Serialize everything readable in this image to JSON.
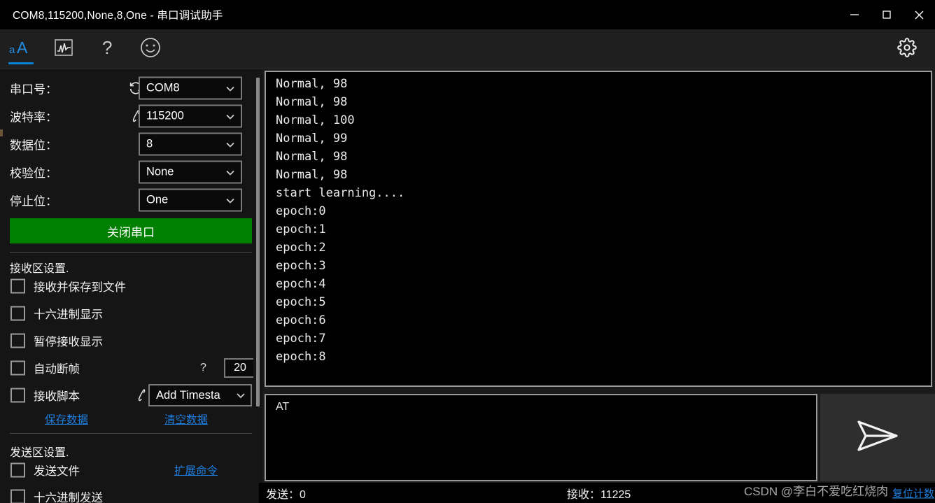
{
  "window": {
    "title": "COM8,115200,None,8,One - 串口调试助手",
    "minimize_label": "minimize",
    "maximize_label": "maximize",
    "close_label": "close"
  },
  "toolbar": {
    "items": [
      {
        "name": "font-size-icon",
        "label": "aA",
        "active": true
      },
      {
        "name": "waveform-plot-icon",
        "label": "waveform",
        "active": false
      },
      {
        "name": "help-question-icon",
        "label": "?",
        "active": false
      },
      {
        "name": "smiley-face-icon",
        "label": "smiley",
        "active": false
      }
    ],
    "settings_label": "gear-icon"
  },
  "sidebar": {
    "port_settings": [
      {
        "label": "串口号：",
        "value": "COM8",
        "icon": "refresh-icon"
      },
      {
        "label": "波特率：",
        "value": "115200",
        "icon": "script-pen-icon"
      },
      {
        "label": "数据位：",
        "value": "8",
        "icon": ""
      },
      {
        "label": "校验位：",
        "value": "None",
        "icon": ""
      },
      {
        "label": "停止位：",
        "value": "One",
        "icon": ""
      }
    ],
    "open_close_button": "关闭串口",
    "receive_section_title": "接收区设置.",
    "receive_checkboxes": [
      {
        "label": "接收并保存到文件",
        "checked": false
      },
      {
        "label": "十六进制显示",
        "checked": false
      },
      {
        "label": "暂停接收显示",
        "checked": false
      },
      {
        "label": "自动断帧",
        "checked": false
      },
      {
        "label": "接收脚本",
        "checked": false
      }
    ],
    "auto_frame_hint": "?",
    "auto_frame_value": "20",
    "receive_script_value": "Add Timesta",
    "save_data_link": "保存数据",
    "clear_data_link": "清空数据",
    "send_section_title": "发送区设置.",
    "send_checkboxes": [
      {
        "label": "发送文件",
        "checked": false
      },
      {
        "label": "十六进制发送",
        "checked": false
      }
    ],
    "extend_command_link": "扩展命令"
  },
  "receive_area": {
    "lines": [
      "Normal, 98",
      "Normal, 98",
      "Normal, 100",
      "Normal, 99",
      "Normal, 98",
      "Normal, 98",
      "start learning....",
      "epoch:0",
      "epoch:1",
      "epoch:2",
      "epoch:3",
      "epoch:4",
      "epoch:5",
      "epoch:6",
      "epoch:7",
      "epoch:8"
    ]
  },
  "send_area": {
    "text": "AT",
    "send_button_icon": "send-paper-plane-icon"
  },
  "status_bar": {
    "sent_label": "发送：0",
    "received_label": "接收：11225",
    "reset_counter_link": "复位计数"
  },
  "watermark": {
    "text": "CSDN @李白不爱吃红烧肉"
  },
  "colors": {
    "accent": "#0a84d8",
    "open_button": "#008000",
    "link": "#1f7fe0",
    "titlebar_bg": "#000000",
    "toolbar_bg": "#1f1f1f",
    "sidebar_bg": "#151515",
    "terminal_bg": "#000000",
    "border": "#9a9a9a"
  }
}
